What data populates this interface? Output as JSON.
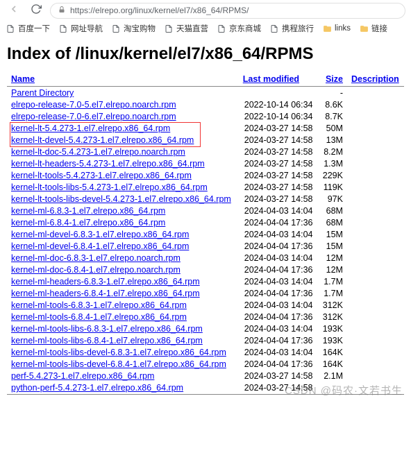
{
  "browser": {
    "url": "https://elrepo.org/linux/kernel/el7/x86_64/RPMS/"
  },
  "bookmarks": [
    {
      "label": "百度一下",
      "icon": "doc"
    },
    {
      "label": "网址导航",
      "icon": "doc"
    },
    {
      "label": "淘宝购物",
      "icon": "doc"
    },
    {
      "label": "天猫直营",
      "icon": "doc"
    },
    {
      "label": "京东商城",
      "icon": "doc"
    },
    {
      "label": "携程旅行",
      "icon": "doc"
    },
    {
      "label": "links",
      "icon": "folder"
    },
    {
      "label": "链接",
      "icon": "folder"
    }
  ],
  "page": {
    "heading": "Index of /linux/kernel/el7/x86_64/RPMS",
    "columns": {
      "name": "Name",
      "modified": "Last modified",
      "size": "Size",
      "desc": "Description"
    },
    "parent_label": "Parent Directory",
    "parent_size": "-",
    "files": [
      {
        "name": "elrepo-release-7.0-5.el7.elrepo.noarch.rpm",
        "mod": "2022-10-14 06:34",
        "size": "8.6K"
      },
      {
        "name": "elrepo-release-7.0-6.el7.elrepo.noarch.rpm",
        "mod": "2022-10-14 06:34",
        "size": "8.7K"
      },
      {
        "name": "kernel-lt-5.4.273-1.el7.elrepo.x86_64.rpm",
        "mod": "2024-03-27 14:58",
        "size": "50M"
      },
      {
        "name": "kernel-lt-devel-5.4.273-1.el7.elrepo.x86_64.rpm",
        "mod": "2024-03-27 14:58",
        "size": "13M"
      },
      {
        "name": "kernel-lt-doc-5.4.273-1.el7.elrepo.noarch.rpm",
        "mod": "2024-03-27 14:58",
        "size": "8.2M"
      },
      {
        "name": "kernel-lt-headers-5.4.273-1.el7.elrepo.x86_64.rpm",
        "mod": "2024-03-27 14:58",
        "size": "1.3M"
      },
      {
        "name": "kernel-lt-tools-5.4.273-1.el7.elrepo.x86_64.rpm",
        "mod": "2024-03-27 14:58",
        "size": "229K"
      },
      {
        "name": "kernel-lt-tools-libs-5.4.273-1.el7.elrepo.x86_64.rpm",
        "mod": "2024-03-27 14:58",
        "size": "119K"
      },
      {
        "name": "kernel-lt-tools-libs-devel-5.4.273-1.el7.elrepo.x86_64.rpm",
        "mod": "2024-03-27 14:58",
        "size": "97K"
      },
      {
        "name": "kernel-ml-6.8.3-1.el7.elrepo.x86_64.rpm",
        "mod": "2024-04-03 14:04",
        "size": "68M"
      },
      {
        "name": "kernel-ml-6.8.4-1.el7.elrepo.x86_64.rpm",
        "mod": "2024-04-04 17:36",
        "size": "68M"
      },
      {
        "name": "kernel-ml-devel-6.8.3-1.el7.elrepo.x86_64.rpm",
        "mod": "2024-04-03 14:04",
        "size": "15M"
      },
      {
        "name": "kernel-ml-devel-6.8.4-1.el7.elrepo.x86_64.rpm",
        "mod": "2024-04-04 17:36",
        "size": "15M"
      },
      {
        "name": "kernel-ml-doc-6.8.3-1.el7.elrepo.noarch.rpm",
        "mod": "2024-04-03 14:04",
        "size": "12M"
      },
      {
        "name": "kernel-ml-doc-6.8.4-1.el7.elrepo.noarch.rpm",
        "mod": "2024-04-04 17:36",
        "size": "12M"
      },
      {
        "name": "kernel-ml-headers-6.8.3-1.el7.elrepo.x86_64.rpm",
        "mod": "2024-04-03 14:04",
        "size": "1.7M"
      },
      {
        "name": "kernel-ml-headers-6.8.4-1.el7.elrepo.x86_64.rpm",
        "mod": "2024-04-04 17:36",
        "size": "1.7M"
      },
      {
        "name": "kernel-ml-tools-6.8.3-1.el7.elrepo.x86_64.rpm",
        "mod": "2024-04-03 14:04",
        "size": "312K"
      },
      {
        "name": "kernel-ml-tools-6.8.4-1.el7.elrepo.x86_64.rpm",
        "mod": "2024-04-04 17:36",
        "size": "312K"
      },
      {
        "name": "kernel-ml-tools-libs-6.8.3-1.el7.elrepo.x86_64.rpm",
        "mod": "2024-04-03 14:04",
        "size": "193K"
      },
      {
        "name": "kernel-ml-tools-libs-6.8.4-1.el7.elrepo.x86_64.rpm",
        "mod": "2024-04-04 17:36",
        "size": "193K"
      },
      {
        "name": "kernel-ml-tools-libs-devel-6.8.3-1.el7.elrepo.x86_64.rpm",
        "mod": "2024-04-03 14:04",
        "size": "164K"
      },
      {
        "name": "kernel-ml-tools-libs-devel-6.8.4-1.el7.elrepo.x86_64.rpm",
        "mod": "2024-04-04 17:36",
        "size": "164K"
      },
      {
        "name": "perf-5.4.273-1.el7.elrepo.x86_64.rpm",
        "mod": "2024-03-27 14:58",
        "size": "2.1M"
      },
      {
        "name": "python-perf-5.4.273-1.el7.elrepo.x86_64.rpm",
        "mod": "2024-03-27 14:58",
        "size": ""
      }
    ]
  },
  "highlight": {
    "row_start": 2,
    "row_end": 3
  },
  "watermark": "CSDN @码农·文若书生"
}
